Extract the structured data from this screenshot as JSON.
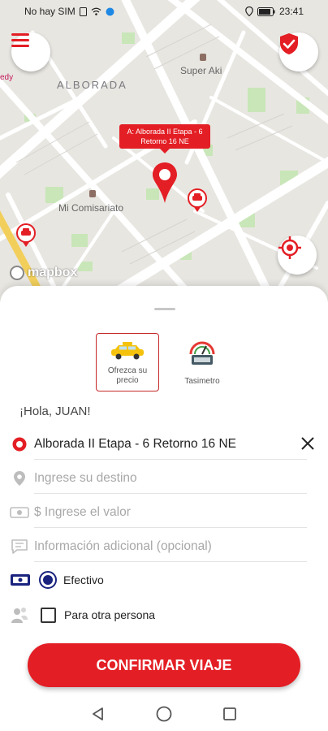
{
  "status_bar": {
    "carrier": "No hay SIM",
    "time": "23:41"
  },
  "map": {
    "area_label": "ALBORADA",
    "store_label": "Super Aki",
    "police_label": "Mi Comisariato",
    "left_edge_label": "edy",
    "pin_callout": "A: Alborada II Etapa - 6 Retorno 16 NE",
    "attribution": "mapbox"
  },
  "services": [
    {
      "label": "Ofrezca su precio",
      "icon": "taxi-car-icon",
      "selected": true
    },
    {
      "label": "Tasimetro",
      "icon": "taximeter-icon",
      "selected": false
    }
  ],
  "greeting": "¡Hola, JUAN!",
  "form": {
    "origin_value": "Alborada II Etapa - 6 Retorno 16 NE",
    "destination_placeholder": "Ingrese su destino",
    "price_placeholder": "$ Ingrese el valor",
    "info_placeholder": "Información adicional (opcional)"
  },
  "payment": {
    "method_label": "Efectivo",
    "selected": true
  },
  "other_person": {
    "label": "Para otra persona",
    "checked": false
  },
  "confirm_button": "CONFIRMAR VIAJE",
  "colors": {
    "accent": "#e31e24",
    "radio": "#1a237e"
  }
}
